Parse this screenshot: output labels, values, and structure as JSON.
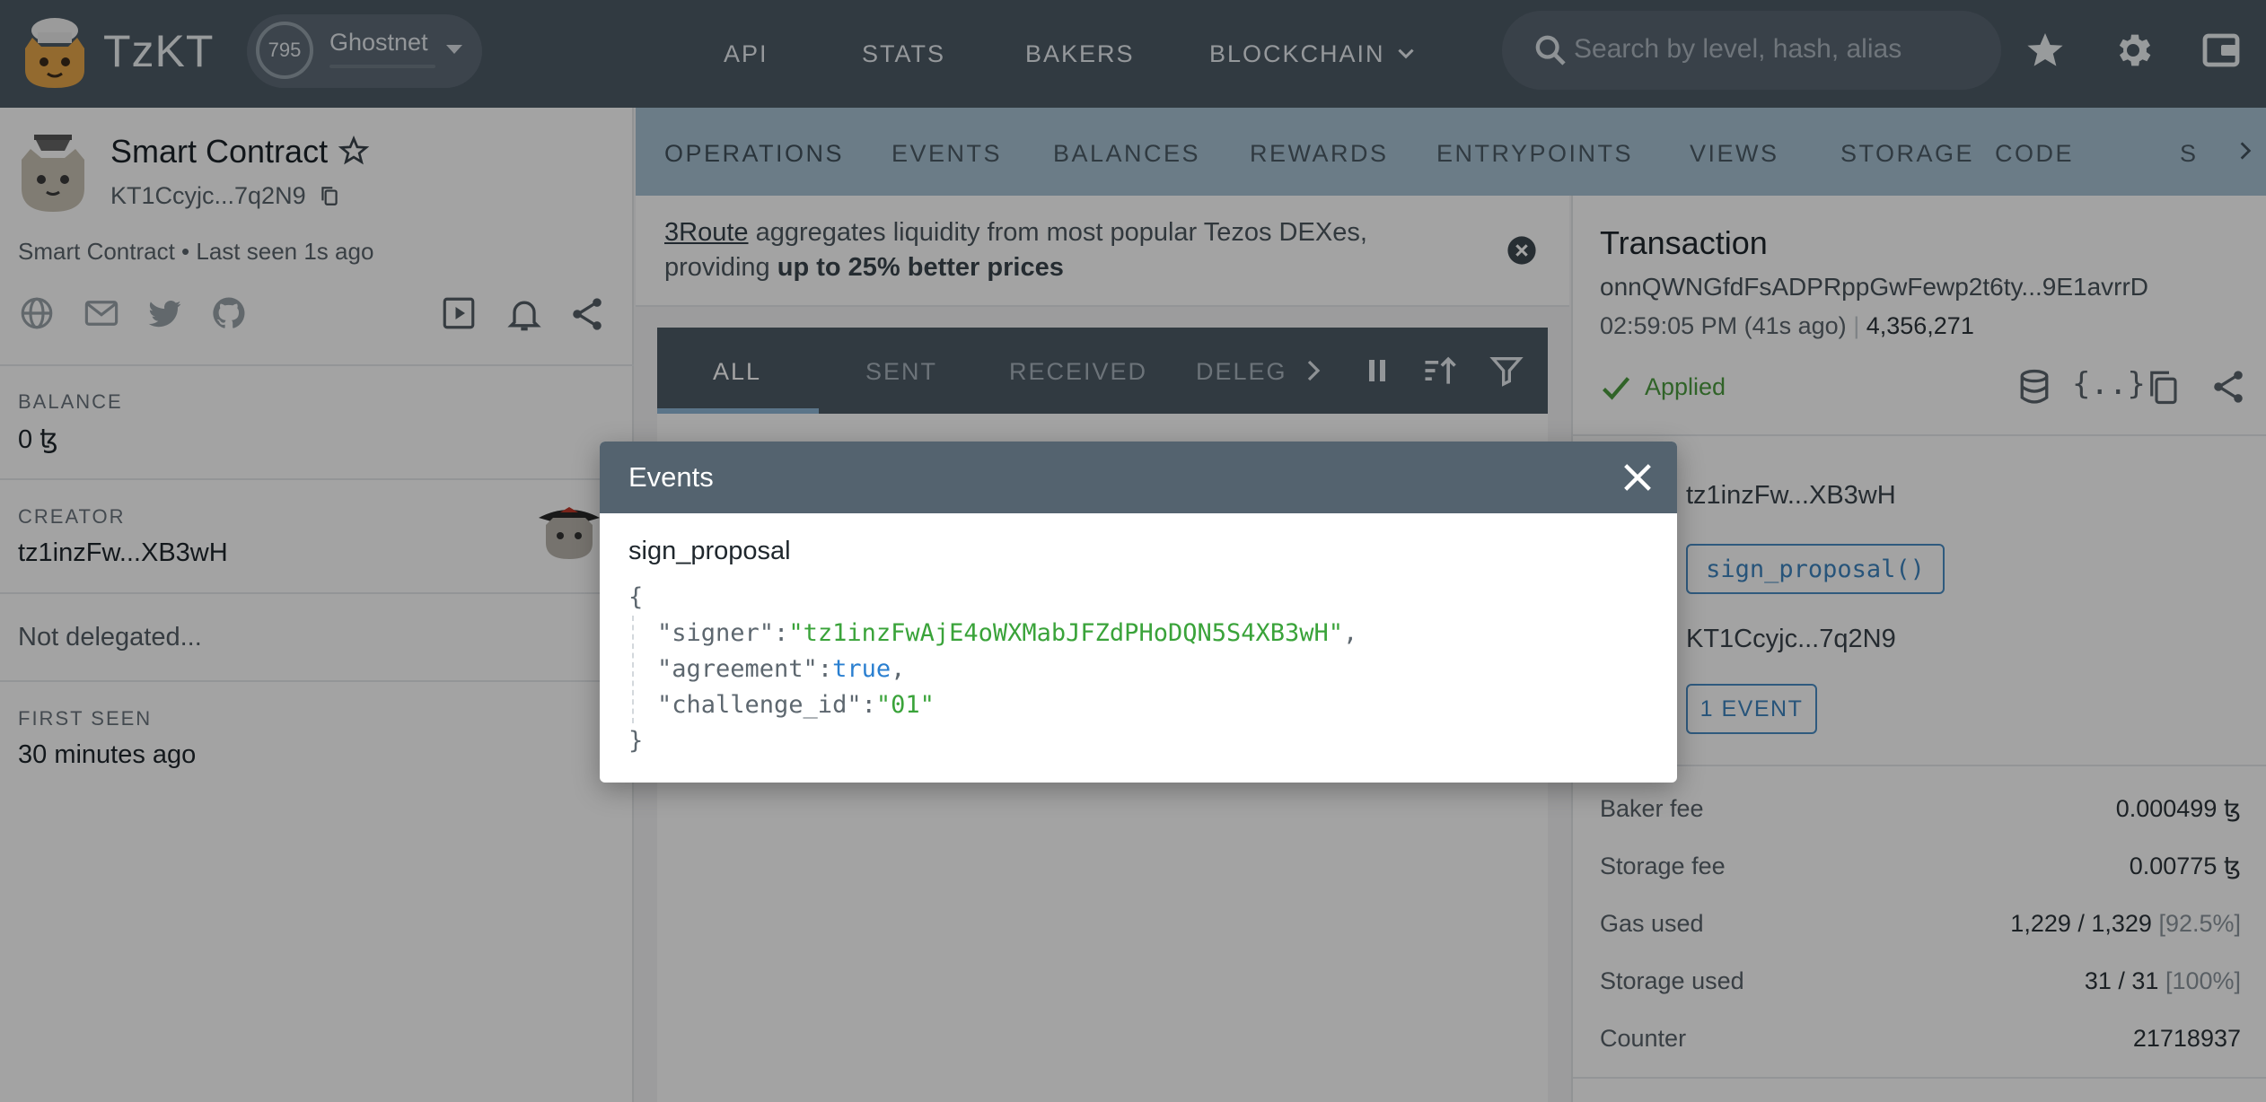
{
  "header": {
    "brand": "TzKT",
    "network": {
      "level": "795",
      "name": "Ghostnet"
    },
    "nav": [
      "API",
      "STATS",
      "BAKERS",
      "BLOCKCHAIN"
    ],
    "search_placeholder": "Search by level, hash, alias",
    "icons": [
      "star-icon",
      "gear-icon",
      "wallet-icon"
    ]
  },
  "sidebar": {
    "title": "Smart Contract",
    "address": "KT1Ccyjc...7q2N9",
    "subtitle": "Smart Contract • Last seen 1s ago",
    "social_icons": [
      "globe-icon",
      "mail-icon",
      "twitter-icon",
      "github-icon"
    ],
    "action_icons": [
      "play-icon",
      "bell-icon",
      "share-icon"
    ],
    "balance": {
      "label": "BALANCE",
      "value": "0 ꜩ"
    },
    "creator": {
      "label": "CREATOR",
      "value": "tz1inzFw...XB3wH"
    },
    "delegation": "Not delegated...",
    "first_seen": {
      "label": "FIRST SEEN",
      "value": "30 minutes ago"
    }
  },
  "tabs": [
    "OPERATIONS",
    "EVENTS",
    "BALANCES",
    "REWARDS",
    "ENTRYPOINTS",
    "VIEWS",
    "STORAGE",
    "CODE",
    "S"
  ],
  "promo": {
    "link": "3Route",
    "text_1": " aggregates liquidity from most popular Tezos DEXes,",
    "text_2": "providing ",
    "strong": "up to 25% better prices"
  },
  "ops_tabs": [
    "ALL",
    "SENT",
    "RECEIVED",
    "DELEG"
  ],
  "detail": {
    "title": "Transaction",
    "hash": "onnQWNGfdFsADPRppGwFewp2t6ty...9E1avrrD",
    "time": "02:59:05 PM (41s ago)",
    "level": "4,356,271",
    "status": "Applied",
    "sender": "tz1inzFw...XB3wH",
    "entrypoint": "sign_proposal()",
    "target": "KT1Ccyjc...7q2N9",
    "events_chip": "1 EVENT",
    "fees": [
      {
        "label": "Baker fee",
        "value": "0.000499 ꜩ",
        "extra": ""
      },
      {
        "label": "Storage fee",
        "value": "0.00775 ꜩ",
        "extra": ""
      },
      {
        "label": "Gas used",
        "value": "1,229 / 1,329 ",
        "extra": "[92.5%]"
      },
      {
        "label": "Storage used",
        "value": "31 / 31 ",
        "extra": "[100%]"
      },
      {
        "label": "Counter",
        "value": "21718937",
        "extra": ""
      }
    ]
  },
  "modal": {
    "title": "Events",
    "event_name": "sign_proposal",
    "payload": {
      "signer_key": "\"signer\"",
      "signer_value": "\"tz1inzFwAjE4oWXMabJFZdPHoDQN5S4XB3wH\"",
      "agreement_key": "\"agreement\"",
      "agreement_value": "true",
      "challenge_key": "\"challenge_id\"",
      "challenge_value": "\"01\""
    }
  },
  "colors": {
    "header": "#4e5b67",
    "tabs": "#a8c3d4",
    "applied": "#4b9c3f",
    "chip": "#3d84bf"
  }
}
